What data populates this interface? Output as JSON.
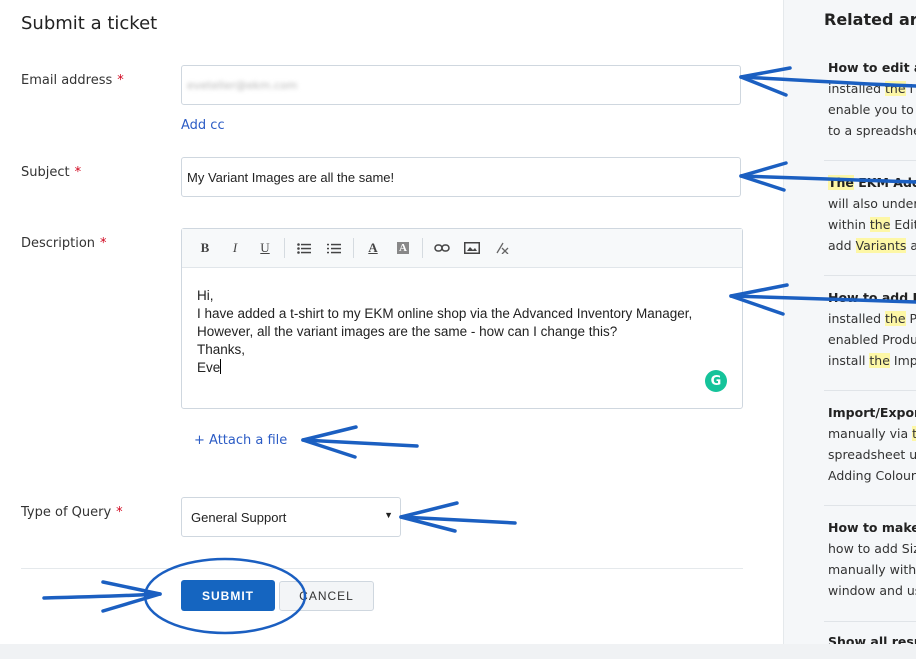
{
  "form": {
    "title": "Submit a ticket",
    "email_label": "Email address",
    "email_value": "eveteller@ekm.com",
    "add_cc": "Add cc",
    "subject_label": "Subject",
    "subject_value": "My Variant Images are all the same!",
    "description_label": "Description",
    "description_lines": [
      "Hi,",
      "I have added a t-shirt to my EKM online shop via the Advanced Inventory Manager,",
      "However, all the variant images are the same - how can I change this?",
      "Thanks,",
      "Eve"
    ],
    "attach_file": "+ Attach a file",
    "query_label": "Type of Query",
    "query_value": "General Support",
    "required_mark": "*",
    "submit_label": "SUBMIT",
    "cancel_label": "CANCEL",
    "toolbar_icons": [
      "bold-icon",
      "italic-icon",
      "underline-icon",
      "bulleted-list-icon",
      "numbered-list-icon",
      "font-color-icon",
      "background-color-icon",
      "link-icon",
      "image-icon",
      "clear-format-icon"
    ],
    "grammarly_icon": "grammarly-icon"
  },
  "sidebar": {
    "title": "Related art",
    "articles": [
      {
        "lines": [
          "How to edit ar",
          "installed the I",
          "enable you to",
          "to a spreadshe"
        ]
      },
      {
        "lines": [
          "The EKM Add/",
          "will also under",
          "within the Edit",
          "add Variants a"
        ]
      },
      {
        "lines": [
          "How to add Pr",
          "installed the P",
          "enabled Produ",
          "install the Imp"
        ]
      },
      {
        "lines": [
          "Import/Expor",
          "manually via t",
          "spreadsheet u",
          "Adding Colour"
        ]
      },
      {
        "lines": [
          "How to make ",
          "how to add Siz",
          "manually with",
          "window and us"
        ]
      }
    ],
    "show_all": "Show all resul"
  },
  "colors": {
    "accent": "#1565c0",
    "link": "#2c5cc5",
    "required": "#d0021b",
    "highlight": "#fdf7a6",
    "annotation": "#1b5fc1"
  }
}
